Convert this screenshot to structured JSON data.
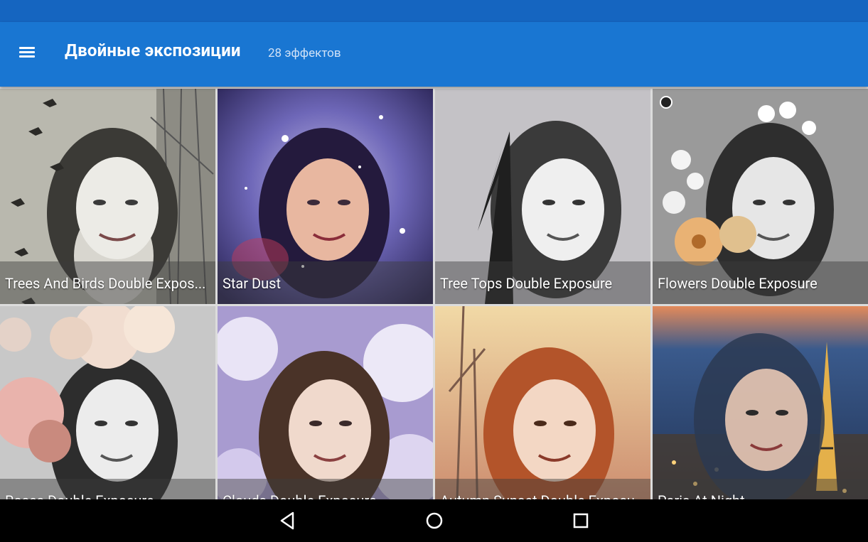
{
  "app_bar": {
    "title": "Двойные экспозиции",
    "subtitle": "28 эффектов",
    "menu_icon": "hamburger-menu-icon",
    "color": "#1976d2",
    "status_color": "#1565c0"
  },
  "effects": [
    {
      "label": "Trees And Birds Double Expos...",
      "theme": "trees-birds",
      "tone": "#9a9a94"
    },
    {
      "label": "Star Dust",
      "theme": "galaxy",
      "tone": "#6a5fb0"
    },
    {
      "label": "Tree Tops Double Exposure",
      "theme": "tree-tops",
      "tone": "#b0b0b0"
    },
    {
      "label": "Flowers Double Exposure",
      "theme": "white-flowers",
      "tone": "#8f8f8f",
      "badge_icon": "sticker-face-icon"
    },
    {
      "label": "Roses Double Exposure",
      "theme": "roses",
      "tone": "#c7c7c7"
    },
    {
      "label": "Clouds Double Exposure",
      "theme": "clouds",
      "tone": "#9c8cc4"
    },
    {
      "label": "Autumn Sunset Double Exposure",
      "theme": "autumn",
      "tone": "#c8845a"
    },
    {
      "label": "Paris At Night",
      "theme": "paris-night",
      "tone": "#2f4f7a"
    }
  ],
  "nav": {
    "back_icon": "back-triangle-icon",
    "home_icon": "home-circle-icon",
    "recents_icon": "recents-square-icon"
  }
}
